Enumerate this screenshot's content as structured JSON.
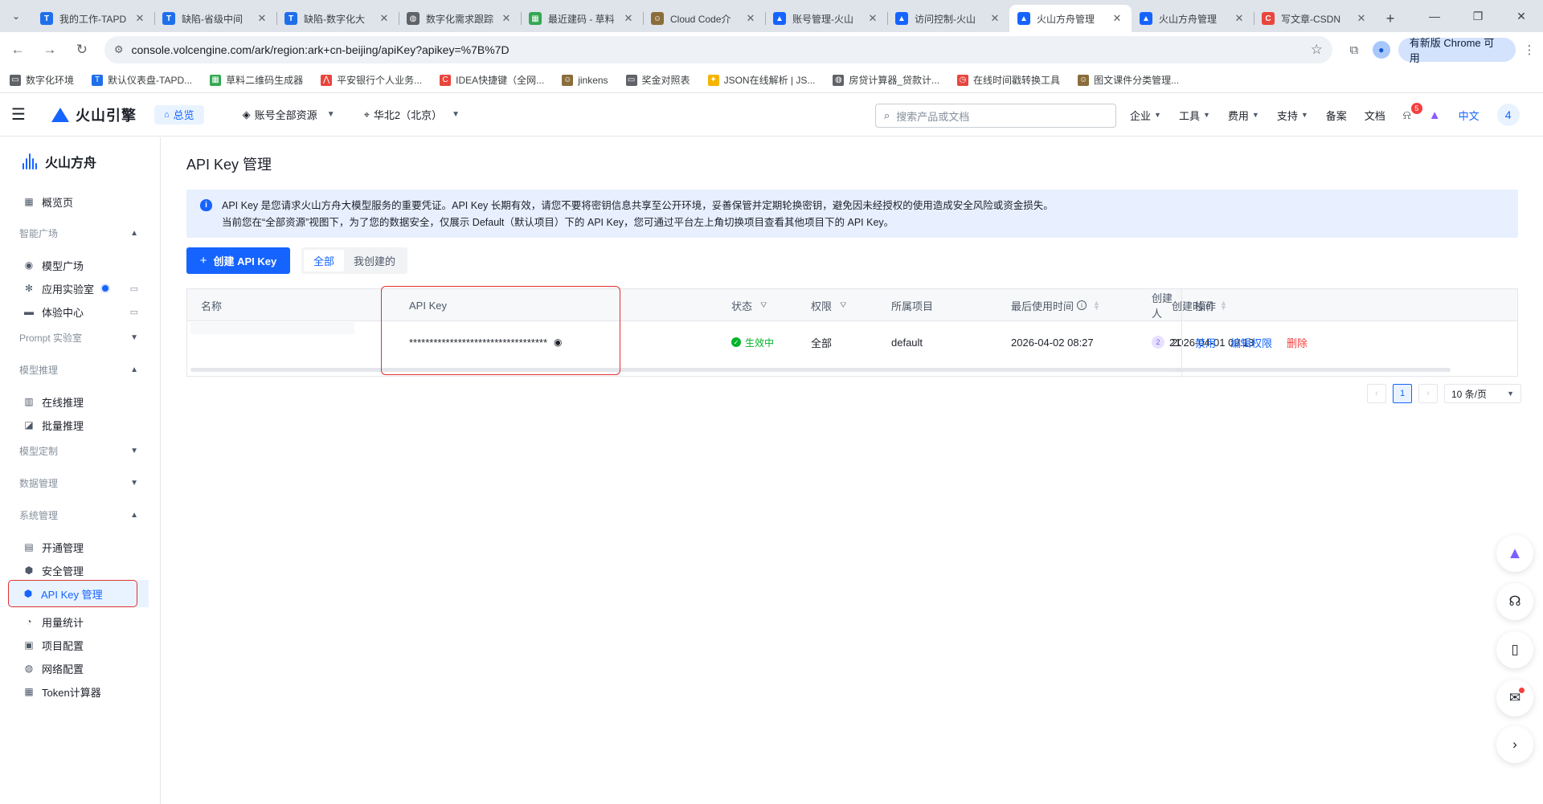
{
  "browser": {
    "tabs": [
      {
        "title": "我的工作-TAPD",
        "color": "#1f6feb",
        "glyph": "T",
        "active": false
      },
      {
        "title": "缺陷-省级中间",
        "color": "#1f6feb",
        "glyph": "T",
        "active": false
      },
      {
        "title": "缺陷-数字化大",
        "color": "#1f6feb",
        "glyph": "T",
        "active": false
      },
      {
        "title": "数字化需求跟踪",
        "color": "#5f6368",
        "glyph": "◍",
        "active": false
      },
      {
        "title": "最近建码 - 草料",
        "color": "#34a853",
        "glyph": "▦",
        "active": false
      },
      {
        "title": "Cloud Code介",
        "color": "#8a6d3b",
        "glyph": "☺",
        "active": false
      },
      {
        "title": "账号管理-火山",
        "color": "#1664ff",
        "glyph": "▲",
        "active": false
      },
      {
        "title": "访问控制-火山",
        "color": "#1664ff",
        "glyph": "▲",
        "active": false
      },
      {
        "title": "火山方舟管理",
        "color": "#1664ff",
        "glyph": "▲",
        "active": true
      },
      {
        "title": "火山方舟管理",
        "color": "#1664ff",
        "glyph": "▲",
        "active": false
      },
      {
        "title": "写文章-CSDN",
        "color": "#e8453c",
        "glyph": "C",
        "active": false
      }
    ],
    "url": "console.volcengine.com/ark/region:ark+cn-beijing/apiKey?apikey=%7B%7D",
    "update_label": "有新版 Chrome 可用",
    "bookmarks": [
      {
        "label": "数字化环境",
        "color": "#5f6368",
        "glyph": "▭"
      },
      {
        "label": "默认仪表盘-TAPD...",
        "color": "#1f6feb",
        "glyph": "T"
      },
      {
        "label": "草料二维码生成器",
        "color": "#34a853",
        "glyph": "▦"
      },
      {
        "label": "平安银行个人业务...",
        "color": "#e8453c",
        "glyph": "⋀"
      },
      {
        "label": "IDEA快捷键（全网...",
        "color": "#e8453c",
        "glyph": "C"
      },
      {
        "label": "jinkens",
        "color": "#8a6d3b",
        "glyph": "☺"
      },
      {
        "label": "奖金对照表",
        "color": "#5f6368",
        "glyph": "▭"
      },
      {
        "label": "JSON在线解析 | JS...",
        "color": "#f4b400",
        "glyph": "✦"
      },
      {
        "label": "房贷计算器_贷款计...",
        "color": "#5f6368",
        "glyph": "◍"
      },
      {
        "label": "在线时间戳转换工具",
        "color": "#e8453c",
        "glyph": "◷"
      },
      {
        "label": "图文课件分类管理...",
        "color": "#8a6d3b",
        "glyph": "☺"
      }
    ]
  },
  "header": {
    "brand": "火山引擎",
    "overview": "总览",
    "resource": "账号全部资源",
    "region": "华北2（北京）",
    "search_placeholder": "搜索产品或文档",
    "menu": [
      {
        "label": "企业",
        "chev": true
      },
      {
        "label": "工具",
        "chev": true
      },
      {
        "label": "费用",
        "chev": true
      },
      {
        "label": "支持",
        "chev": true
      },
      {
        "label": "备案",
        "chev": false
      },
      {
        "label": "文档",
        "chev": false
      }
    ],
    "bell_count": "5",
    "lang": "中文",
    "avatar": "4"
  },
  "sidebar": {
    "brand": "火山方舟",
    "overview": "概览页",
    "groups": {
      "square": "智能广场",
      "prompt": "Prompt 实验室",
      "inference": "模型推理",
      "custom": "模型定制",
      "data": "数据管理",
      "system": "系统管理"
    },
    "items": {
      "model_square": "模型广场",
      "app_lab": "应用实验室",
      "experience": "体验中心",
      "online": "在线推理",
      "batch": "批量推理",
      "activation": "开通管理",
      "security": "安全管理",
      "apikey": "API Key 管理",
      "usage": "用量统计",
      "project": "项目配置",
      "network": "网络配置",
      "token": "Token计算器"
    }
  },
  "main": {
    "title": "API Key 管理",
    "notice_line1": "API Key 是您请求火山方舟大模型服务的重要凭证。API Key 长期有效，请您不要将密钥信息共享至公开环境，妥善保管并定期轮换密钥，避免因未经授权的使用造成安全风险或资金损失。",
    "notice_line2": "当前您在“全部资源”视图下，为了您的数据安全，仅展示 Default（默认项目）下的 API Key，您可通过平台左上角切换项目查看其他项目下的 API Key。",
    "create_label": "创建 API Key",
    "seg": [
      "全部",
      "我创建的"
    ],
    "columns": {
      "name": "名称",
      "apikey": "API Key",
      "status": "状态",
      "perm": "权限",
      "project": "所属项目",
      "last_used": "最后使用时间",
      "created": "创建时间",
      "creator": "创建人",
      "ops": "操作"
    },
    "rows": [
      {
        "apikey": "**********************************",
        "status": "生效中",
        "perm": "全部",
        "project": "default",
        "last_used": "2026-04-02 08:27",
        "created": "2026-04-01 09:13",
        "creator_badge": "2",
        "creator": "2123",
        "ops": [
          "禁用",
          "编辑权限",
          "删除"
        ]
      }
    ],
    "pagination": {
      "current": "1",
      "size": "10 条/页"
    }
  }
}
